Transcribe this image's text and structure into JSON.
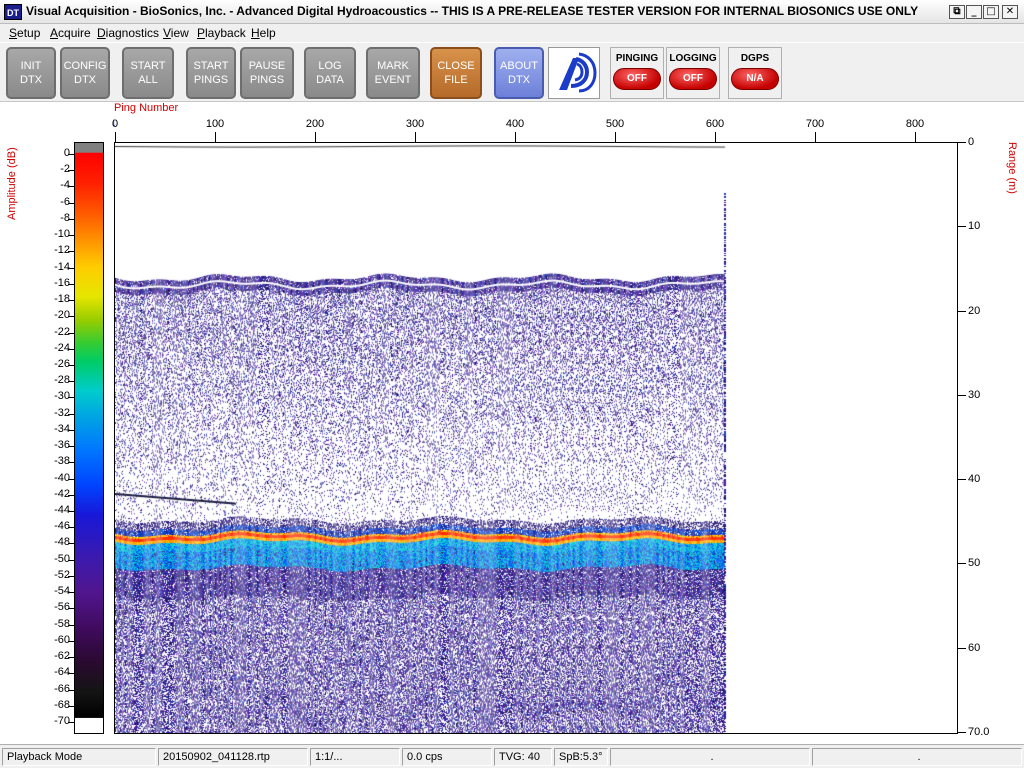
{
  "window": {
    "title": "Visual Acquisition  -  BioSonics, Inc.  -  Advanced Digital Hydroacoustics  -- THIS IS A PRE-RELEASE TESTER VERSION FOR INTERNAL BIOSONICS USE ONLY",
    "icon_text": "DT",
    "restore_glyph": "⧉",
    "minimize_glyph": "_",
    "maximize_glyph": "□",
    "close_glyph": "✕"
  },
  "menu": {
    "items": [
      {
        "ul": "S",
        "rest": "etup"
      },
      {
        "ul": "A",
        "rest": "cquire"
      },
      {
        "ul": "D",
        "rest": "iagnostics"
      },
      {
        "ul": "V",
        "rest": "iew"
      },
      {
        "ul": "P",
        "rest": "layback"
      },
      {
        "ul": "H",
        "rest": "elp"
      }
    ]
  },
  "toolbar": {
    "buttons": [
      {
        "line1": "INIT",
        "line2": "DTX"
      },
      {
        "line1": "CONFIG",
        "line2": "DTX"
      },
      {
        "line1": "START",
        "line2": "ALL"
      },
      {
        "line1": "START",
        "line2": "PINGS"
      },
      {
        "line1": "PAUSE",
        "line2": "PINGS"
      },
      {
        "line1": "LOG",
        "line2": "DATA"
      },
      {
        "line1": "MARK",
        "line2": "EVENT"
      },
      {
        "line1": "CLOSE",
        "line2": "FILE"
      },
      {
        "line1": "ABOUT",
        "line2": "DTX"
      }
    ],
    "logo_icon": "biosonics-logo-icon",
    "indicators": [
      {
        "label": "PINGING",
        "state": "OFF"
      },
      {
        "label": "LOGGING",
        "state": "OFF"
      },
      {
        "label": "DGPS",
        "state": "N/A"
      }
    ]
  },
  "plot": {
    "amplitude_title": "Amplitude (dB)",
    "range_title": "Range (m)",
    "ping_title": "Ping Number",
    "ping_marker_glyph": "↓",
    "colorbar_ticks": [
      "0",
      "-2",
      "-4",
      "-6",
      "-8",
      "-10",
      "-12",
      "-14",
      "-16",
      "-18",
      "-20",
      "-22",
      "-24",
      "-26",
      "-28",
      "-30",
      "-32",
      "-34",
      "-36",
      "-38",
      "-40",
      "-42",
      "-44",
      "-46",
      "-48",
      "-50",
      "-52",
      "-54",
      "-56",
      "-58",
      "-60",
      "-62",
      "-64",
      "-66",
      "-68",
      "-70"
    ],
    "ping_ticks": [
      "0",
      "100",
      "200",
      "300",
      "400",
      "500",
      "600",
      "700",
      "800"
    ],
    "range_ticks": [
      "0",
      "10",
      "20",
      "30",
      "40",
      "50",
      "60",
      "70.0"
    ],
    "colors": {
      "title_red": "#d00000",
      "data_top": "#1f1f7a",
      "data_mid": "#4e19a0",
      "bottom_echo_red": "#ff2a00",
      "bottom_echo_cyan": "#00c8d8",
      "bottom_echo_blue": "#0060f0"
    }
  },
  "status": {
    "mode": "Playback Mode",
    "file": "20150902_041128.rtp",
    "ratio": "1:1/...",
    "rate": "0.0 cps",
    "tvg": "TVG: 40",
    "spb": "SpB:5.3°",
    "cell7": ".",
    "cell8": "."
  }
}
